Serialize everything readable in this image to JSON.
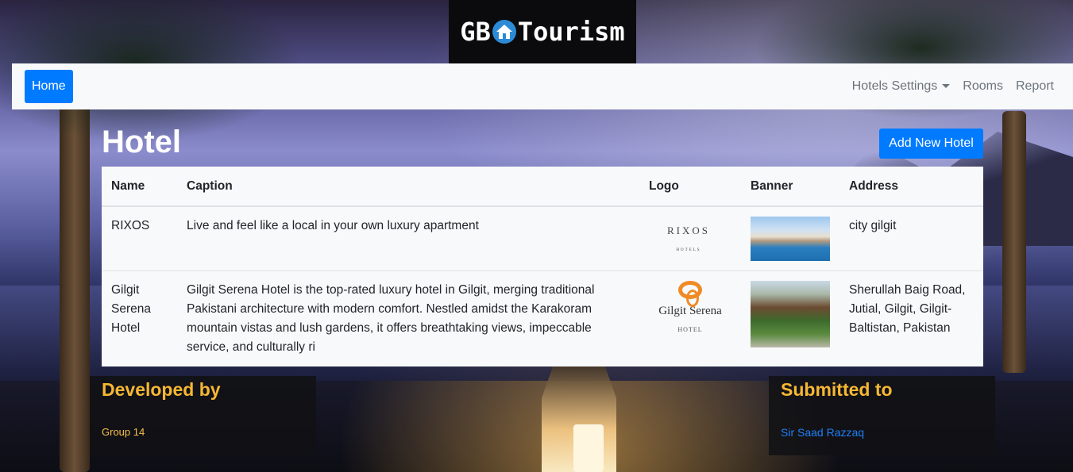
{
  "brand": {
    "left": "GB",
    "right": "Tourism"
  },
  "navbar": {
    "home": "Home",
    "items": [
      {
        "label": "Hotels Settings"
      },
      {
        "label": "Rooms"
      },
      {
        "label": "Report"
      }
    ]
  },
  "page": {
    "title": "Hotel",
    "add_button": "Add New Hotel"
  },
  "table": {
    "headers": [
      "Name",
      "Caption",
      "Logo",
      "Banner",
      "Address"
    ],
    "rows": [
      {
        "name": "RIXOS",
        "caption": "Live and feel like a local in your own luxury apartment",
        "logo_text": "RIXOS",
        "logo_sub": "HOTELS",
        "address": "city gilgit"
      },
      {
        "name": "Gilgit Serena Hotel",
        "caption": "Gilgit Serena Hotel is the top-rated luxury hotel in Gilgit, merging traditional Pakistani architecture with modern comfort. Nestled amidst the Karakoram mountain vistas and lush gardens, it offers breathtaking views, impeccable service, and culturally ri",
        "logo_text": "Gilgit Serena",
        "logo_sub": "HOTEL",
        "address": "Sherullah Baig Road, Jutial, Gilgit, Gilgit-Baltistan, Pakistan"
      }
    ]
  },
  "footer": {
    "developed_heading": "Developed by",
    "developed_text": "Group 14",
    "submitted_heading": "Submitted to",
    "submitted_link": "Sir Saad Razzaq"
  },
  "colors": {
    "primary": "#007bff",
    "footer_heading": "#f7b733",
    "navbar_bg": "#f8f9fa"
  }
}
